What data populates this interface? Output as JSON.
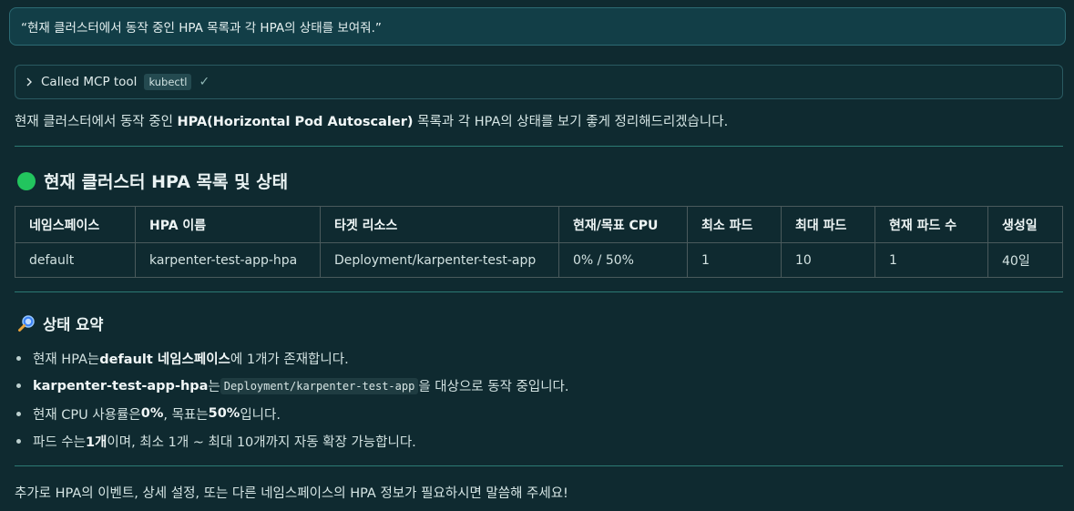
{
  "prompt": "“현재 클러스터에서 동작 중인 HPA 목록과 각 HPA의 상태를 보여줘.”",
  "tool_call": {
    "label": "Called MCP tool",
    "tool_name": "kubectl"
  },
  "intro": {
    "before": "현재 클러스터에서 동작 중인 ",
    "bold": "HPA(Horizontal Pod Autoscaler)",
    "after": " 목록과 각 HPA의 상태를 보기 좋게 정리해드리겠습니다."
  },
  "section1": {
    "icon": "green-circle-icon",
    "title": "현재 클러스터 HPA 목록 및 상태"
  },
  "table": {
    "headers": [
      "네임스페이스",
      "HPA 이름",
      "타겟 리소스",
      "현재/목표 CPU",
      "최소 파드",
      "최대 파드",
      "현재 파드 수",
      "생성일"
    ],
    "rows": [
      [
        "default",
        "karpenter-test-app-hpa",
        "Deployment/karpenter-test-app",
        "0% / 50%",
        "1",
        "10",
        "1",
        "40일"
      ]
    ]
  },
  "section2": {
    "icon": "magnifier-icon",
    "title": "상태 요약"
  },
  "summary": [
    {
      "p1": "현재 HPA는 ",
      "b1": "default 네임스페이스",
      "p2": "에 1개가 존재합니다."
    },
    {
      "b1": "karpenter-test-app-hpa",
      "p1": "는 ",
      "code": "Deployment/karpenter-test-app",
      "p2": "을 대상으로 동작 중입니다."
    },
    {
      "p1": "현재 CPU 사용률은 ",
      "b1": "0%",
      "p2": ", 목표는 ",
      "b2": "50%",
      "p3": "입니다."
    },
    {
      "p1": "파드 수는 ",
      "b1": "1개",
      "p2": "이며, 최소 1개 ~ 최대 10개까지 자동 확장 가능합니다."
    }
  ],
  "outro": "추가로 HPA의 이벤트, 상세 설정, 또는 다른 네임스페이스의 HPA 정보가 필요하시면 말씀해 주세요!",
  "colors": {
    "background": "#0f2a30",
    "accent": "#2c7a73",
    "status_dot": "#22c55e"
  }
}
